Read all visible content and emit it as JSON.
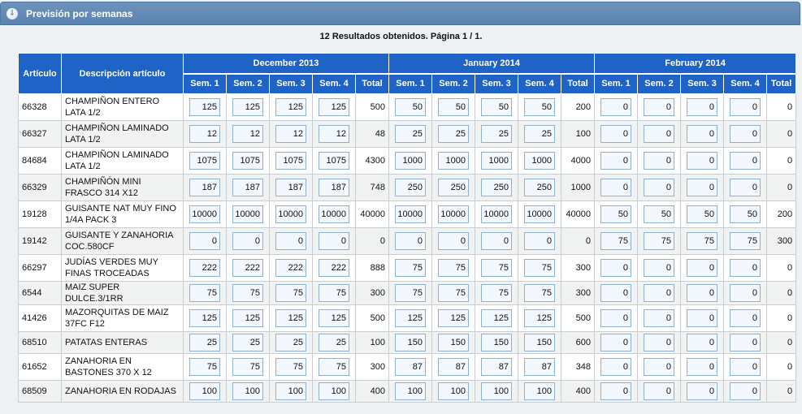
{
  "panel": {
    "title": "Previsión por semanas",
    "icon": "chevron-down-icon"
  },
  "results_text": "12 Resultados obtenidos. Página 1 / 1.",
  "headers": {
    "articulo": "Artículo",
    "descripcion": "Descripción artículo",
    "months": [
      "December 2013",
      "January 2014",
      "February 2014"
    ],
    "weeks": [
      "Sem. 1",
      "Sem. 2",
      "Sem. 3",
      "Sem. 4",
      "Total"
    ]
  },
  "rows": [
    {
      "art": "66328",
      "desc": "CHAMPIÑON ENTERO LATA 1/2",
      "months": [
        {
          "weeks": [
            "125",
            "125",
            "125",
            "125"
          ],
          "total": "500"
        },
        {
          "weeks": [
            "50",
            "50",
            "50",
            "50"
          ],
          "total": "200"
        },
        {
          "weeks": [
            "0",
            "0",
            "0",
            "0"
          ],
          "total": "0"
        }
      ]
    },
    {
      "art": "66327",
      "desc": "CHAMPIÑON LAMINADO LATA 1/2",
      "months": [
        {
          "weeks": [
            "12",
            "12",
            "12",
            "12"
          ],
          "total": "48"
        },
        {
          "weeks": [
            "25",
            "25",
            "25",
            "25"
          ],
          "total": "100"
        },
        {
          "weeks": [
            "0",
            "0",
            "0",
            "0"
          ],
          "total": "0"
        }
      ]
    },
    {
      "art": "84684",
      "desc": "CHAMPIÑON LAMINADO LATA 1/2",
      "months": [
        {
          "weeks": [
            "1075",
            "1075",
            "1075",
            "1075"
          ],
          "total": "4300"
        },
        {
          "weeks": [
            "1000",
            "1000",
            "1000",
            "1000"
          ],
          "total": "4000"
        },
        {
          "weeks": [
            "0",
            "0",
            "0",
            "0"
          ],
          "total": "0"
        }
      ]
    },
    {
      "art": "66329",
      "desc": "CHAMPIÑÓN MINI FRASCO 314 X12",
      "months": [
        {
          "weeks": [
            "187",
            "187",
            "187",
            "187"
          ],
          "total": "748"
        },
        {
          "weeks": [
            "250",
            "250",
            "250",
            "250"
          ],
          "total": "1000"
        },
        {
          "weeks": [
            "0",
            "0",
            "0",
            "0"
          ],
          "total": "0"
        }
      ]
    },
    {
      "art": "19128",
      "desc": "GUISANTE NAT MUY FINO 1/4A PACK 3",
      "months": [
        {
          "weeks": [
            "10000",
            "10000",
            "10000",
            "10000"
          ],
          "total": "40000"
        },
        {
          "weeks": [
            "10000",
            "10000",
            "10000",
            "10000"
          ],
          "total": "40000"
        },
        {
          "weeks": [
            "50",
            "50",
            "50",
            "50"
          ],
          "total": "200"
        }
      ]
    },
    {
      "art": "19142",
      "desc": "GUISANTE Y ZANAHORIA COC.580CF",
      "months": [
        {
          "weeks": [
            "0",
            "0",
            "0",
            "0"
          ],
          "total": "0"
        },
        {
          "weeks": [
            "0",
            "0",
            "0",
            "0"
          ],
          "total": "0"
        },
        {
          "weeks": [
            "75",
            "75",
            "75",
            "75"
          ],
          "total": "300"
        }
      ]
    },
    {
      "art": "66297",
      "desc": "JUDÍAS VERDES MUY FINAS TROCEADAS",
      "months": [
        {
          "weeks": [
            "222",
            "222",
            "222",
            "222"
          ],
          "total": "888"
        },
        {
          "weeks": [
            "75",
            "75",
            "75",
            "75"
          ],
          "total": "300"
        },
        {
          "weeks": [
            "0",
            "0",
            "0",
            "0"
          ],
          "total": "0"
        }
      ]
    },
    {
      "art": "6544",
      "desc": "MAIZ SUPER DULCE.3/1RR",
      "short": true,
      "months": [
        {
          "weeks": [
            "75",
            "75",
            "75",
            "75"
          ],
          "total": "300"
        },
        {
          "weeks": [
            "75",
            "75",
            "75",
            "75"
          ],
          "total": "300"
        },
        {
          "weeks": [
            "0",
            "0",
            "0",
            "0"
          ],
          "total": "0"
        }
      ]
    },
    {
      "art": "41426",
      "desc": "MAZORQUITAS DE MAIZ 37FC F12",
      "months": [
        {
          "weeks": [
            "125",
            "125",
            "125",
            "125"
          ],
          "total": "500"
        },
        {
          "weeks": [
            "125",
            "125",
            "125",
            "125"
          ],
          "total": "500"
        },
        {
          "weeks": [
            "0",
            "0",
            "0",
            "0"
          ],
          "total": "0"
        }
      ]
    },
    {
      "art": "68510",
      "desc": "PATATAS ENTERAS",
      "short": true,
      "months": [
        {
          "weeks": [
            "25",
            "25",
            "25",
            "25"
          ],
          "total": "100"
        },
        {
          "weeks": [
            "150",
            "150",
            "150",
            "150"
          ],
          "total": "600"
        },
        {
          "weeks": [
            "0",
            "0",
            "0",
            "0"
          ],
          "total": "0"
        }
      ]
    },
    {
      "art": "61652",
      "desc": "ZANAHORIA EN BASTONES 370 X 12",
      "months": [
        {
          "weeks": [
            "75",
            "75",
            "75",
            "75"
          ],
          "total": "300"
        },
        {
          "weeks": [
            "87",
            "87",
            "87",
            "87"
          ],
          "total": "348"
        },
        {
          "weeks": [
            "0",
            "0",
            "0",
            "0"
          ],
          "total": "0"
        }
      ]
    },
    {
      "art": "68509",
      "desc": "ZANAHORIA EN RODAJAS",
      "short": true,
      "months": [
        {
          "weeks": [
            "100",
            "100",
            "100",
            "100"
          ],
          "total": "400"
        },
        {
          "weeks": [
            "100",
            "100",
            "100",
            "100"
          ],
          "total": "400"
        },
        {
          "weeks": [
            "0",
            "0",
            "0",
            "0"
          ],
          "total": "0"
        }
      ]
    }
  ]
}
